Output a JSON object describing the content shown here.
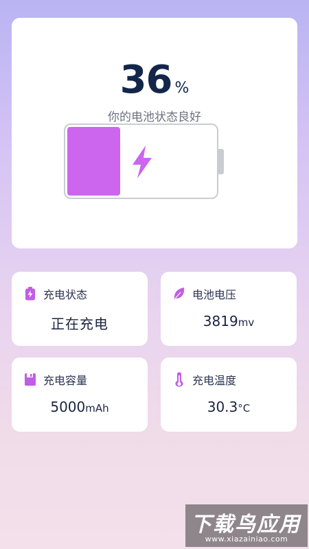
{
  "battery": {
    "percent_value": "36",
    "percent_sign": "%",
    "status_text": "你的电池状态良好",
    "level_fraction": 0.36
  },
  "cards": {
    "charge_state": {
      "title": "充电状态",
      "value": "正在充电"
    },
    "voltage": {
      "title": "电池电压",
      "value": "3819",
      "unit": "mv"
    },
    "capacity": {
      "title": "充电容量",
      "value": "5000",
      "unit": "mAh"
    },
    "temperature": {
      "title": "充电温度",
      "value": "30.3",
      "unit": "°C"
    }
  },
  "colors": {
    "accent": "#cc66ee",
    "text_dark": "#13264a",
    "battery_outline": "#c9ccd1"
  },
  "icons": [
    "battery-charging-icon",
    "leaf-icon",
    "sd-card-icon",
    "thermometer-icon",
    "lightning-bolt-icon"
  ],
  "watermark": {
    "main": "下载鸟应用",
    "url": "www.xiazainiao.com"
  }
}
